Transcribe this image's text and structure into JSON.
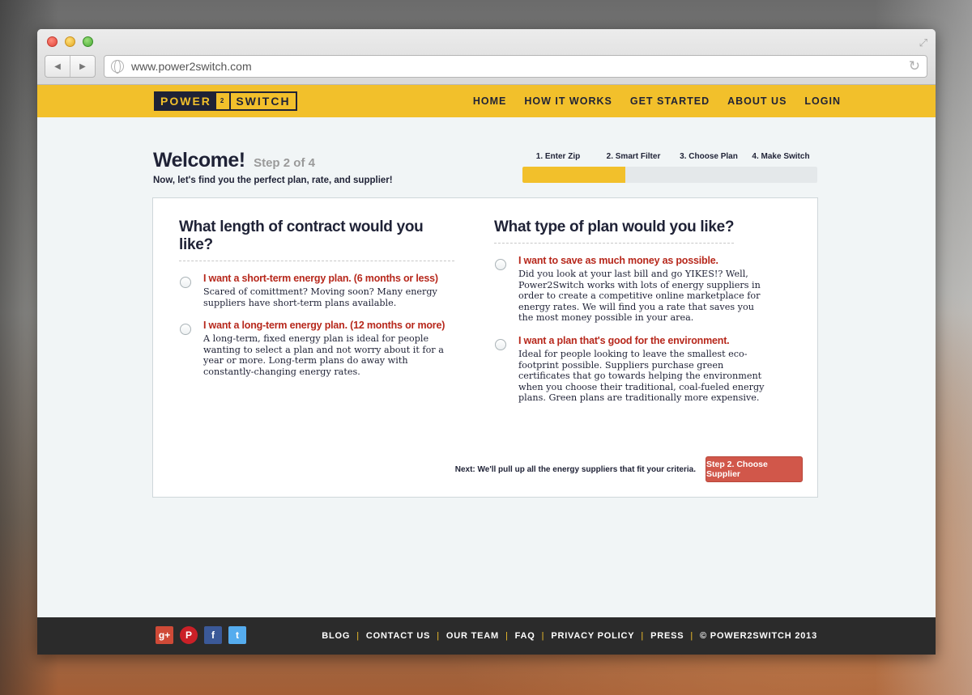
{
  "browser": {
    "url": "www.power2switch.com"
  },
  "header": {
    "logo_left": "POWER",
    "logo_mid": "2",
    "logo_right": "SWITCH",
    "nav": [
      "HOME",
      "HOW IT WORKS",
      "GET STARTED",
      "ABOUT US",
      "LOGIN"
    ],
    "accent_color": "#f2c02b"
  },
  "welcome": {
    "title": "Welcome!",
    "step": "Step 2 of 4",
    "subtitle": "Now, let's find you the perfect plan, rate, and supplier!"
  },
  "progress": {
    "steps": [
      "1. Enter Zip",
      "2. Smart Filter",
      "3. Choose Plan",
      "4. Make Switch"
    ],
    "completed_fraction": 0.35
  },
  "contract": {
    "heading": "What length of contract would you like?",
    "options": [
      {
        "title": "I want a short-term energy plan. (6 months or less)",
        "description": "Scared of comittment? Moving soon? Many energy suppliers have short-term plans available."
      },
      {
        "title": "I want a long-term energy plan. (12 months or more)",
        "description": "A long-term, fixed energy plan is ideal for people wanting to select a plan and not worry about it for a year or more. Long-term plans do away with constantly-changing energy rates."
      }
    ]
  },
  "plan_type": {
    "heading": "What type of plan would you like?",
    "options": [
      {
        "title": "I want to save as much money as possible.",
        "description": "Did you look at your last bill and go YIKES!? Well, Power2Switch works with lots of energy suppliers in order to create a competitive online marketplace for energy rates. We will find you a rate that saves you the most money possible in your area."
      },
      {
        "title": "I want a plan that's good for the environment.",
        "description": "Ideal for people looking to leave the smallest eco-footprint possible. Suppliers purchase green certificates that go towards helping the environment when you choose their traditional, coal-fueled energy plans. Green plans are traditionally more expensive."
      }
    ]
  },
  "next": {
    "text": "Next: We'll pull up all the energy suppliers that fit your criteria.",
    "button_label": "Step 2. Choose Supplier"
  },
  "footer": {
    "social": [
      "g+",
      "P",
      "f",
      "t"
    ],
    "links": [
      "BLOG",
      "CONTACT US",
      "OUR TEAM",
      "FAQ",
      "PRIVACY POLICY",
      "PRESS",
      "© POWER2SWITCH 2013"
    ]
  }
}
